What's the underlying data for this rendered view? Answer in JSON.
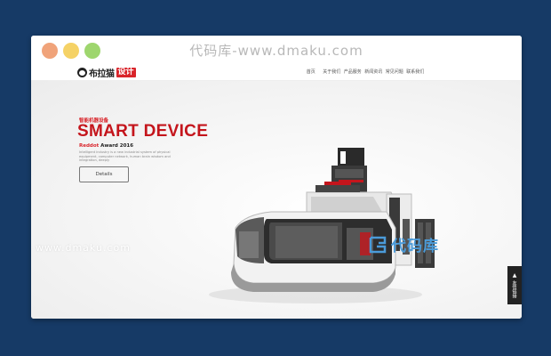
{
  "watermark_top": "代码库-www.dmaku.com",
  "watermark_bottom_left": "www.dmaku.com",
  "watermark_bottom_right": "代码库",
  "logo": {
    "text": "布拉猫",
    "badge": "设计"
  },
  "nav": [
    "首页",
    "关于我们",
    "产品服务",
    "新闻资讯",
    "常见问题",
    "联系我们"
  ],
  "hero": {
    "kicker": "智能机器设备",
    "headline": "SMART DEVICE",
    "award_red": "Reddot",
    "award_rest": " Award 2016",
    "description": "Intelligent industry is a new industrial system of physical equipment, computer network, human brain wisdom and integration, deeply",
    "button": "Details"
  },
  "side_tab": {
    "label": "友情链接",
    "arrow": "▲"
  },
  "colors": {
    "background": "#163a66",
    "accent_red": "#c4151c",
    "watermark_blue": "#4b9bd9"
  }
}
